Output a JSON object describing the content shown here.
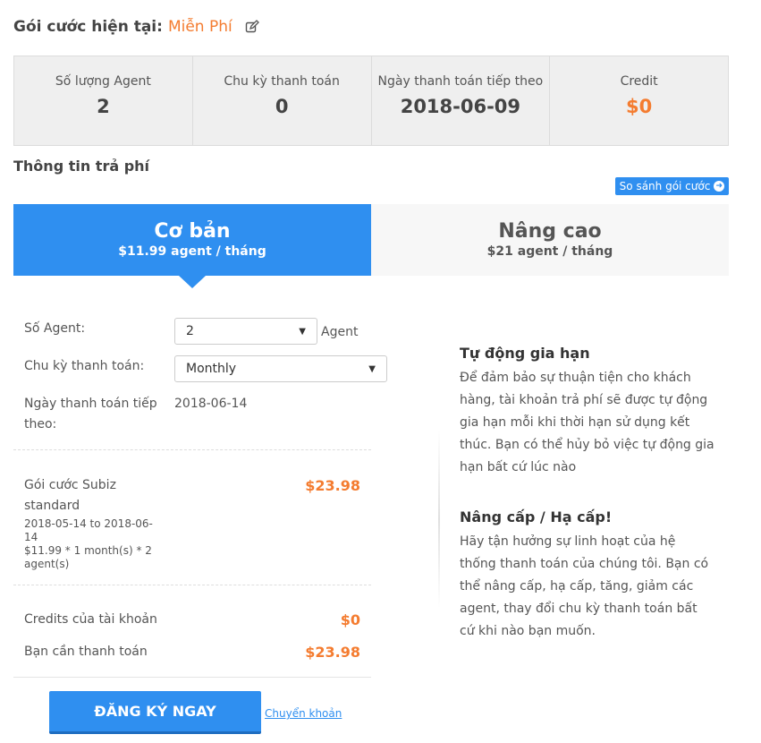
{
  "header": {
    "label": "Gói cước hiện tại:",
    "plan": "Miễn Phí"
  },
  "stats": [
    {
      "label": "Số lượng Agent",
      "value": "2"
    },
    {
      "label": "Chu kỳ thanh toán",
      "value": "0"
    },
    {
      "label": "Ngày thanh toán tiếp theo",
      "value": "2018-06-09"
    },
    {
      "label": "Credit",
      "value": "$0"
    }
  ],
  "payment": {
    "title": "Thông tin trả phí",
    "compare_label": "So sánh gói cước"
  },
  "tabs": [
    {
      "name": "Cơ bản",
      "price": "$11.99 agent / tháng",
      "active": true
    },
    {
      "name": "Nâng cao",
      "price": "$21 agent / tháng",
      "active": false
    }
  ],
  "form": {
    "agent_label": "Số Agent:",
    "agent_value": "2",
    "agent_unit": "Agent",
    "cycle_label": "Chu kỳ thanh toán:",
    "cycle_value": "Monthly",
    "next_date_label": "Ngày thanh toán tiếp theo:",
    "next_date_value": "2018-06-14",
    "package_label": "Gói cước Subiz standard",
    "package_range": "2018-05-14 to 2018-06-14",
    "package_formula": "$11.99 * 1 month(s) * 2 agent(s)",
    "package_amount": "$23.98",
    "credits_label": "Credits của tài khoản",
    "credits_amount": "$0",
    "total_label": "Bạn cần thanh toán",
    "total_amount": "$23.98"
  },
  "info": {
    "renew_title": "Tự động gia hạn",
    "renew_text": "Để đảm bảo sự thuận tiện cho khách hàng, tài khoản trả phí sẽ được tự động gia hạn mỗi khi thời hạn sử dụng kết thúc. Bạn có thể hủy bỏ việc tự động gia hạn bất cứ lúc nào",
    "upgrade_title": "Nâng cấp / Hạ cấp!",
    "upgrade_text": "Hãy tận hưởng sự linh hoạt của hệ thống thanh toán của chúng tôi. Bạn có thể nâng cấp, hạ cấp, tăng, giảm các agent, thay đổi chu kỳ thanh toán bất cứ khi nào bạn muốn."
  },
  "actions": {
    "register_label": "ĐĂNG KÝ NGAY",
    "transfer_label": "Chuyển khoản"
  },
  "colors": {
    "accent": "#2f8ff0",
    "orange": "#f47c30"
  }
}
